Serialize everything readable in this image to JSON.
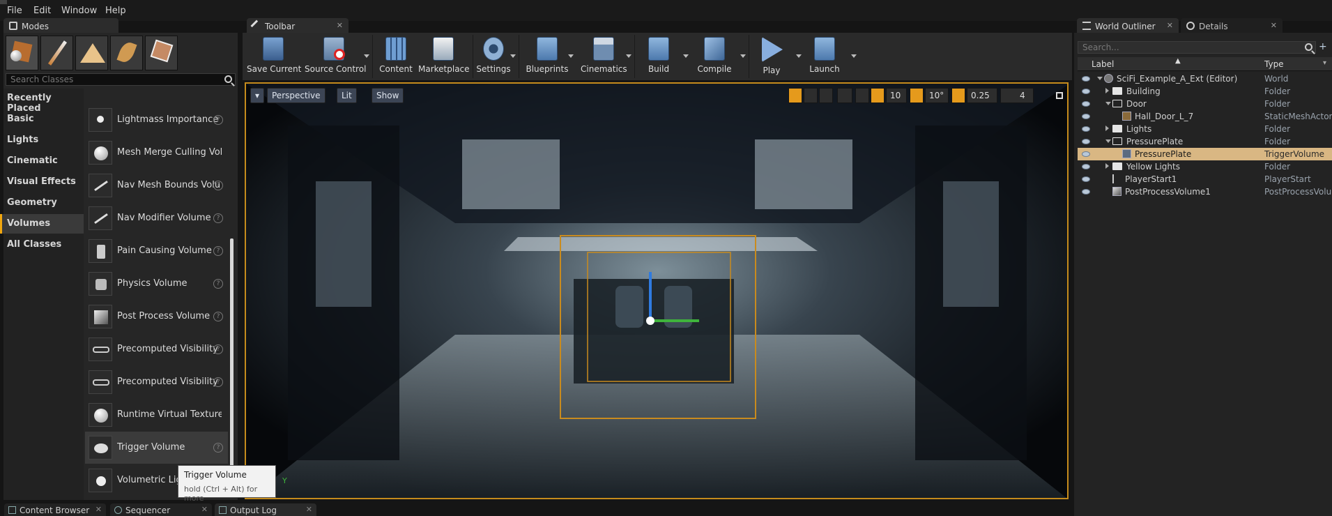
{
  "menu": [
    "File",
    "Edit",
    "Window",
    "Help"
  ],
  "panels": {
    "modes_tab": "Modes",
    "toolbar_tab": "Toolbar",
    "outliner_tab": "World Outliner",
    "details_tab": "Details"
  },
  "modes": {
    "search_placeholder": "Search Classes",
    "categories": [
      "Recently Placed",
      "Basic",
      "Lights",
      "Cinematic",
      "Visual Effects",
      "Geometry",
      "Volumes",
      "All Classes"
    ],
    "selected_category": "Volumes",
    "items": [
      "Lightmass Importance",
      "Mesh Merge Culling Volum",
      "Nav Mesh Bounds Volu",
      "Nav Modifier Volume",
      "Pain Causing Volume",
      "Physics Volume",
      "Post Process Volume",
      "Precomputed Visibility",
      "Precomputed Visibility",
      "Runtime Virtual Texture Vo",
      "Trigger Volume",
      "Volumetric Ligh"
    ],
    "selected_item": "Trigger Volume"
  },
  "toolbar": {
    "buttons": [
      "Save Current",
      "Source Control",
      "Content",
      "Marketplace",
      "Settings",
      "Blueprints",
      "Cinematics",
      "Build",
      "Compile",
      "Play",
      "Launch"
    ]
  },
  "viewport": {
    "perspective": "Perspective",
    "lit": "Lit",
    "show": "Show",
    "grid_snap": "10",
    "rot_snap": "10°",
    "scale_snap": "0.25",
    "cam_speed": "4",
    "axis_label": "Y"
  },
  "tooltip": {
    "title": "Trigger Volume",
    "hint": "hold (Ctrl + Alt) for more"
  },
  "outliner": {
    "search_placeholder": "Search...",
    "col_label": "Label",
    "col_type": "Type",
    "rows": [
      {
        "label": "SciFi_Example_A_Ext (Editor)",
        "type": "World"
      },
      {
        "label": "Building",
        "type": "Folder"
      },
      {
        "label": "Door",
        "type": "Folder"
      },
      {
        "label": "Hall_Door_L_7",
        "type": "StaticMeshActor"
      },
      {
        "label": "Lights",
        "type": "Folder"
      },
      {
        "label": "PressurePlate",
        "type": "Folder"
      },
      {
        "label": "PressurePlate",
        "type": "TriggerVolume"
      },
      {
        "label": "Yellow Lights",
        "type": "Folder"
      },
      {
        "label": "PlayerStart1",
        "type": "PlayerStart"
      },
      {
        "label": "PostProcessVolume1",
        "type": "PostProcessVolum"
      }
    ]
  },
  "bottom_tabs": [
    "Content Browser",
    "Sequencer",
    "Output Log"
  ],
  "colors": {
    "accent": "#f1a70f",
    "selection": "#d9b783",
    "viewport_border": "#c58b1c"
  }
}
